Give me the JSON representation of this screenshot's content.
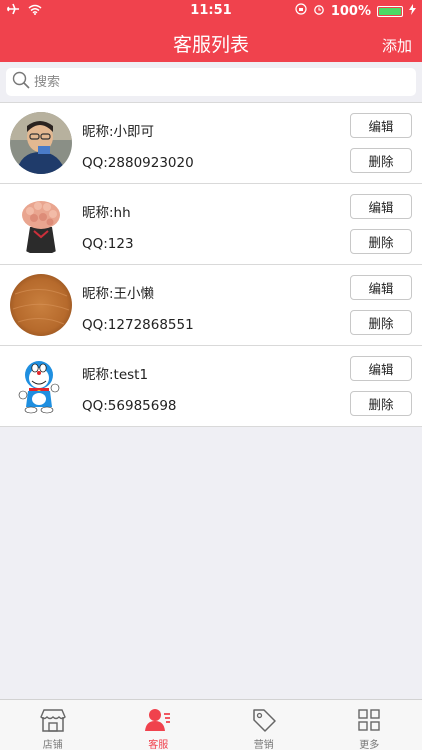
{
  "status_bar": {
    "time": "11:51",
    "battery": "100%"
  },
  "nav": {
    "title": "客服列表",
    "add_label": "添加"
  },
  "search": {
    "placeholder": "搜索",
    "value": ""
  },
  "buttons": {
    "edit": "编辑",
    "delete": "删除"
  },
  "agents": [
    {
      "nickname": "昵称:小即可",
      "qq": "QQ:2880923020",
      "avatar": "photo-man-avatar"
    },
    {
      "nickname": "昵称:hh",
      "qq": "QQ:123",
      "avatar": "flower-bouquet-avatar"
    },
    {
      "nickname": "昵称:王小懒",
      "qq": "QQ:1272868551",
      "avatar": "brown-texture-avatar"
    },
    {
      "nickname": "昵称:test1",
      "qq": "QQ:56985698",
      "avatar": "doraemon-avatar"
    }
  ],
  "tabs": [
    {
      "label": "店铺",
      "icon": "store-icon",
      "active": false
    },
    {
      "label": "客服",
      "icon": "customer-service-icon",
      "active": true
    },
    {
      "label": "营销",
      "icon": "tag-icon",
      "active": false
    },
    {
      "label": "更多",
      "icon": "grid-icon",
      "active": false
    }
  ],
  "colors": {
    "brand": "#f0424d",
    "background": "#efeff4",
    "battery": "#4cd964"
  }
}
